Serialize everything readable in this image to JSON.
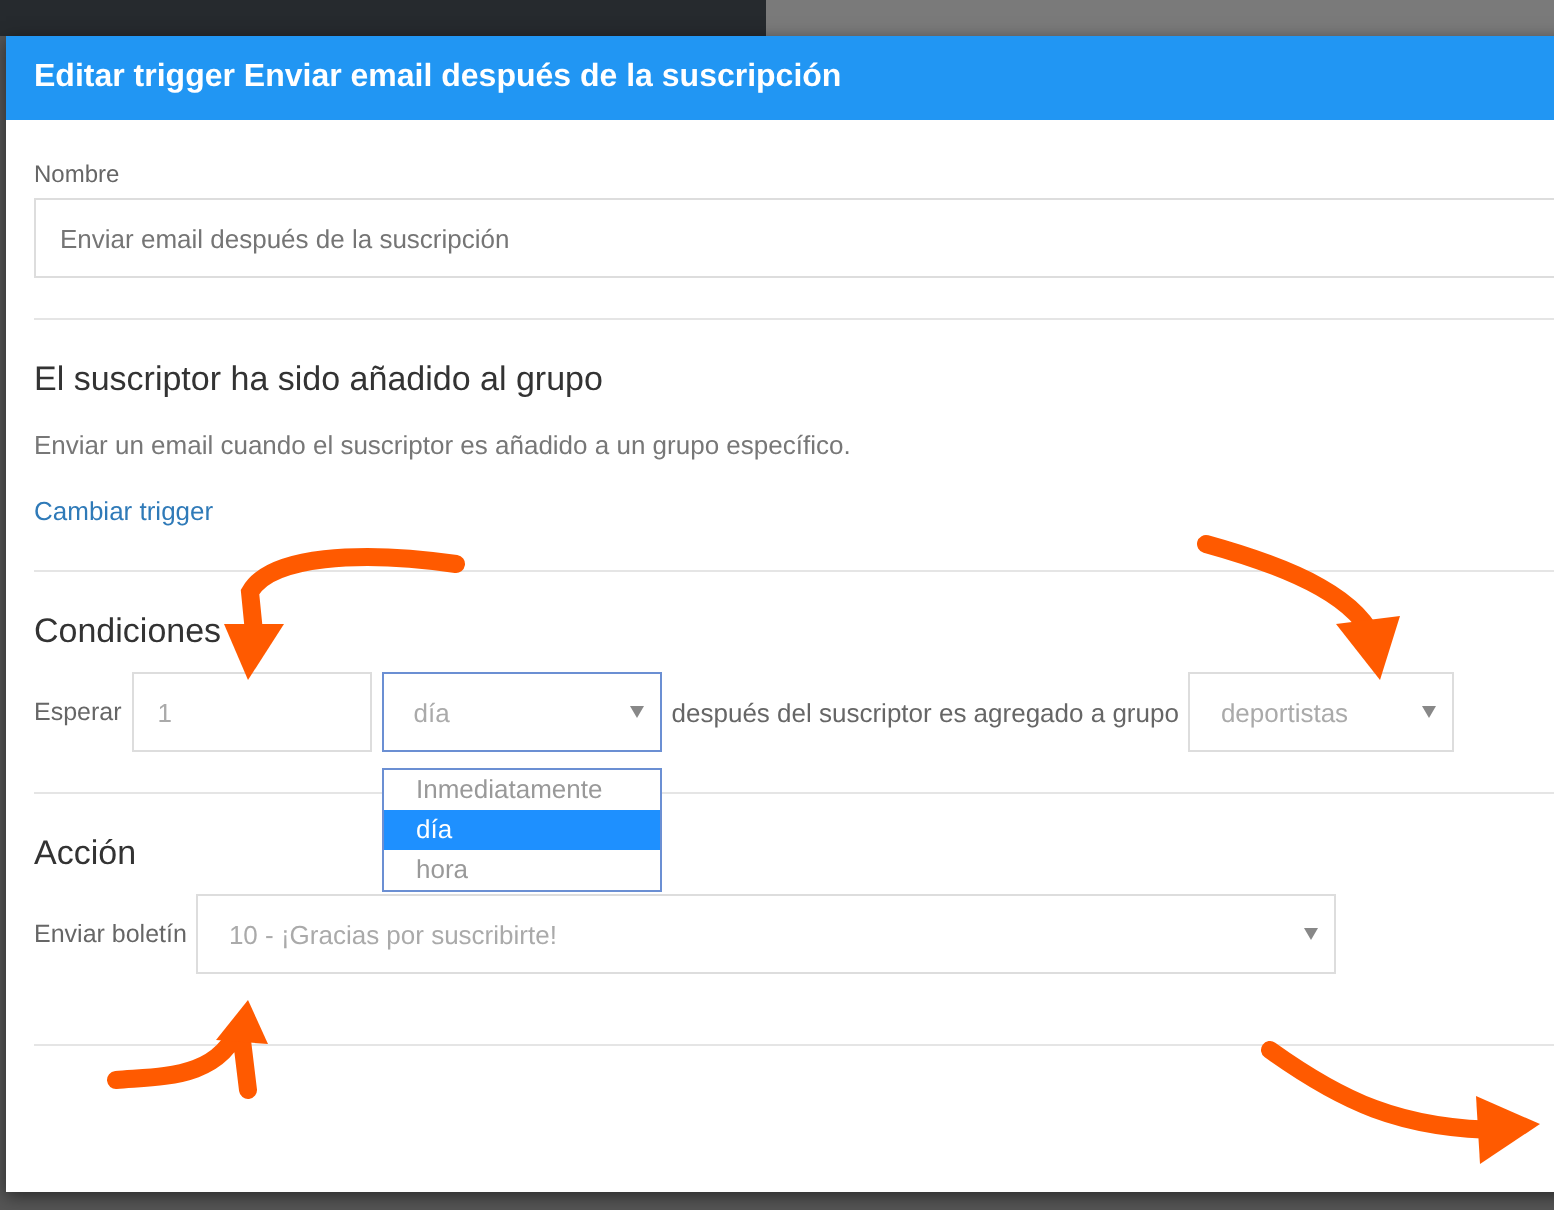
{
  "dialog": {
    "title": "Editar trigger Enviar email después de la suscripción"
  },
  "name_field": {
    "label": "Nombre",
    "placeholder": "Enviar email después de la suscripción"
  },
  "trigger": {
    "heading": "El suscriptor ha sido añadido al grupo",
    "description": "Enviar un email cuando el suscriptor es añadido a un grupo específico.",
    "link": "Cambiar trigger"
  },
  "conditions": {
    "heading": "Condiciones",
    "wait_label": "Esperar",
    "wait_value": "1",
    "unit_select": {
      "value": "día",
      "expanded": true,
      "options": [
        {
          "label": "Inmediatamente",
          "selected": false
        },
        {
          "label": "día",
          "selected": true
        },
        {
          "label": "hora",
          "selected": false
        }
      ]
    },
    "middle_text": "después del suscriptor es agregado a grupo",
    "group_select": {
      "value": "deportistas"
    }
  },
  "action": {
    "heading": "Acción",
    "label": "Enviar boletín",
    "select": {
      "value": "10 - ¡Gracias por suscribirte!"
    }
  }
}
